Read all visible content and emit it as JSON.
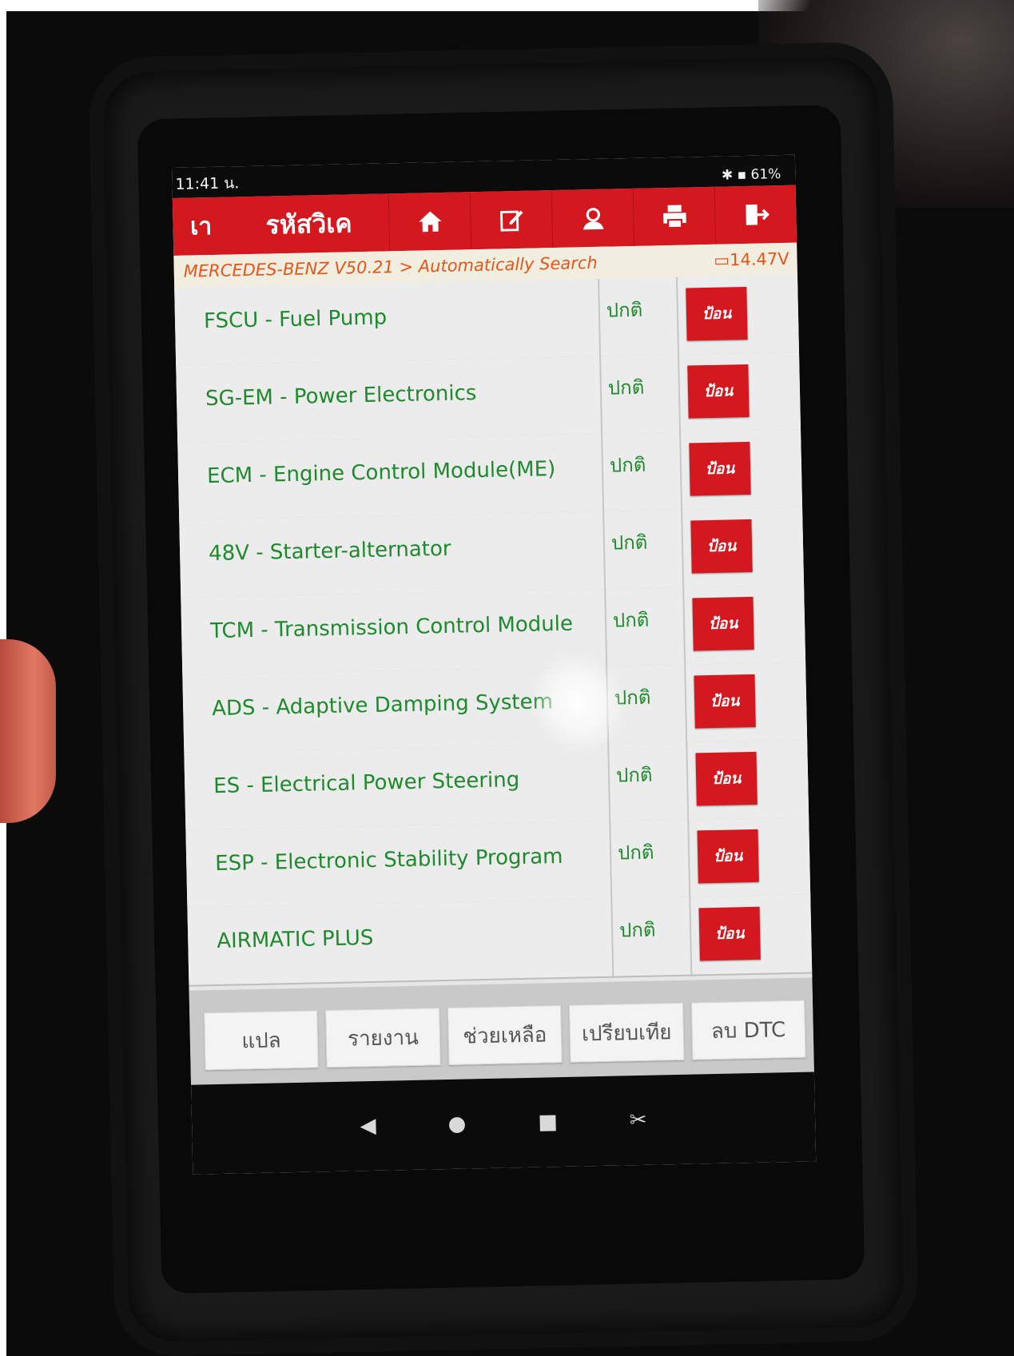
{
  "status_bar": {
    "time": "11:41 น.",
    "battery": "61%"
  },
  "toolbar": {
    "back_label": "เา",
    "title": "รหัสวิเค"
  },
  "breadcrumb": {
    "path": "MERCEDES-BENZ V50.21 > Automatically Search",
    "voltage": "14.47V"
  },
  "modules": [
    {
      "name": "FSCU - Fuel Pump",
      "status": "ปกติ",
      "action": "ป้อน"
    },
    {
      "name": "SG-EM - Power Electronics",
      "status": "ปกติ",
      "action": "ป้อน"
    },
    {
      "name": "ECM - Engine Control Module(ME)",
      "status": "ปกติ",
      "action": "ป้อน"
    },
    {
      "name": "48V - Starter-alternator",
      "status": "ปกติ",
      "action": "ป้อน"
    },
    {
      "name": "TCM - Transmission Control Module",
      "status": "ปกติ",
      "action": "ป้อน"
    },
    {
      "name": "ADS - Adaptive Damping System",
      "status": "ปกติ",
      "action": "ป้อน"
    },
    {
      "name": "ES - Electrical Power Steering",
      "status": "ปกติ",
      "action": "ป้อน"
    },
    {
      "name": "ESP - Electronic Stability Program",
      "status": "ปกติ",
      "action": "ป้อน"
    },
    {
      "name": "AIRMATIC PLUS",
      "status": "ปกติ",
      "action": "ป้อน"
    }
  ],
  "bottom_buttons": [
    "แปล",
    "รายงาน",
    "ช่วยเหลือ",
    "เปรียบเทีย",
    "ลบ DTC"
  ],
  "icons": [
    "home-icon",
    "edit-icon",
    "user-icon",
    "print-icon",
    "exit-icon"
  ],
  "colors": {
    "accent": "#d3181f",
    "module_text": "#1f8a2d",
    "breadcrumb_text": "#e2571d"
  }
}
